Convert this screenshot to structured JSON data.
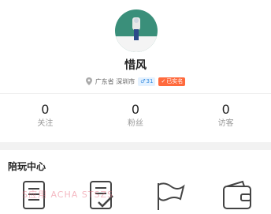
{
  "profile": {
    "name": "惜风",
    "location": "广东省 深圳市",
    "gender_age": "31",
    "verify_label": "已实名"
  },
  "stats": [
    {
      "value": "0",
      "label": "关注"
    },
    {
      "value": "0",
      "label": "粉丝"
    },
    {
      "value": "0",
      "label": "访客"
    }
  ],
  "section": {
    "title": "陪玩中心"
  },
  "watermark": "S应用 ACHA STSZS",
  "icons": [
    "document-list-icon",
    "checklist-icon",
    "flag-icon",
    "wallet-icon"
  ],
  "colors": {
    "avatar_bg": "#3a8f7a",
    "verify": "#ff6a3d",
    "gender_badge": "#3a8fe0"
  }
}
